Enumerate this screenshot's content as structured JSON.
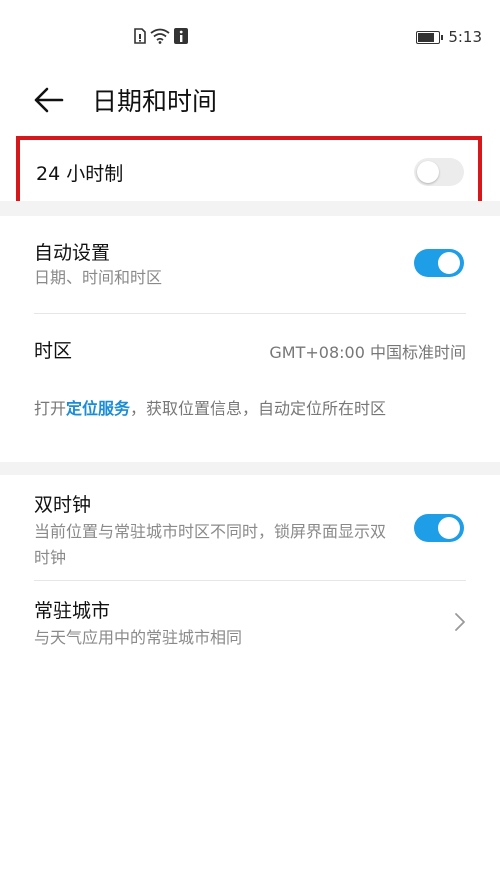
{
  "status_bar": {
    "icons": [
      "sim-card-icon",
      "wifi-icon",
      "info-icon"
    ],
    "battery_icon": "battery-charging-icon",
    "time": "5:13"
  },
  "header": {
    "back_icon": "arrow-left-icon",
    "title": "日期和时间"
  },
  "settings": {
    "hour24": {
      "label": "24 小时制",
      "enabled": false
    },
    "auto_set": {
      "title": "自动设置",
      "subtitle": "日期、时间和时区",
      "enabled": true
    },
    "timezone": {
      "label": "时区",
      "value": "GMT+08:00 中国标准时间"
    },
    "location_note": {
      "prefix": "打开",
      "link": "定位服务",
      "suffix": "，获取位置信息，自动定位所在时区"
    },
    "dual_clock": {
      "title": "双时钟",
      "subtitle": "当前位置与常驻城市时区不同时，锁屏界面显示双时钟",
      "enabled": true
    },
    "home_city": {
      "title": "常驻城市",
      "subtitle": "与天气应用中的常驻城市相同",
      "chevron_icon": "chevron-right-icon"
    }
  },
  "colors": {
    "accent": "#1f9ee8",
    "highlight_border": "#d8171b",
    "link": "#1a8cd8"
  }
}
